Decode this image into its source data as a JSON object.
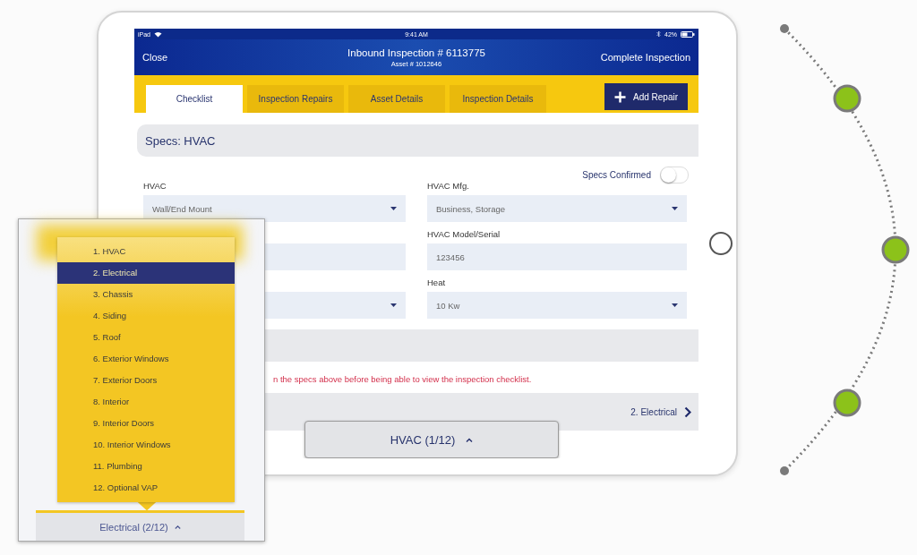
{
  "status_bar": {
    "device": "iPad",
    "time": "9:41 AM",
    "battery": "42%"
  },
  "header": {
    "left_action": "Close",
    "title": "Inbound Inspection # 6113775",
    "subtitle": "Asset # 1012646",
    "right_action": "Complete Inspection"
  },
  "tabs": [
    {
      "label": "Checklist",
      "selected": true
    },
    {
      "label": "Inspection Repairs",
      "selected": false
    },
    {
      "label": "Asset Details",
      "selected": false
    },
    {
      "label": "Inspection Details",
      "selected": false
    }
  ],
  "add_button": "Add Repair",
  "section_title": "Specs: HVAC",
  "specs_confirmed": {
    "label": "Specs Confirmed",
    "on": false
  },
  "fields": [
    {
      "label": "HVAC",
      "value": "Wall/End Mount",
      "kind": "dropdown"
    },
    {
      "label": "HVAC Mfg.",
      "value": "Business, Storage",
      "kind": "dropdown"
    },
    {
      "kind": "text"
    },
    {
      "label": "HVAC Model/Serial",
      "value": "123456",
      "kind": "text"
    },
    {
      "kind": "dropdown"
    },
    {
      "label": "Heat",
      "value": "10 Kw",
      "kind": "dropdown"
    }
  ],
  "warning": "n the specs above before being able to view the inspection checklist.",
  "footer": {
    "current": "HVAC (1/12)",
    "next": "2. Electrical"
  },
  "inset": {
    "items": [
      {
        "label": "1. HVAC",
        "selected": false
      },
      {
        "label": "2. Electrical",
        "selected": true
      },
      {
        "label": "3. Chassis",
        "selected": false
      },
      {
        "label": "4. Siding",
        "selected": false
      },
      {
        "label": "5. Roof",
        "selected": false
      },
      {
        "label": "6. Exterior Windows",
        "selected": false
      },
      {
        "label": "7. Exterior Doors",
        "selected": false
      },
      {
        "label": "8. Interior",
        "selected": false
      },
      {
        "label": "9. Interior Doors",
        "selected": false
      },
      {
        "label": "10. Interior Windows",
        "selected": false
      },
      {
        "label": "11. Plumbing",
        "selected": false
      },
      {
        "label": "12. Optional VAP",
        "selected": false
      }
    ],
    "current": "Electrical (2/12)"
  }
}
